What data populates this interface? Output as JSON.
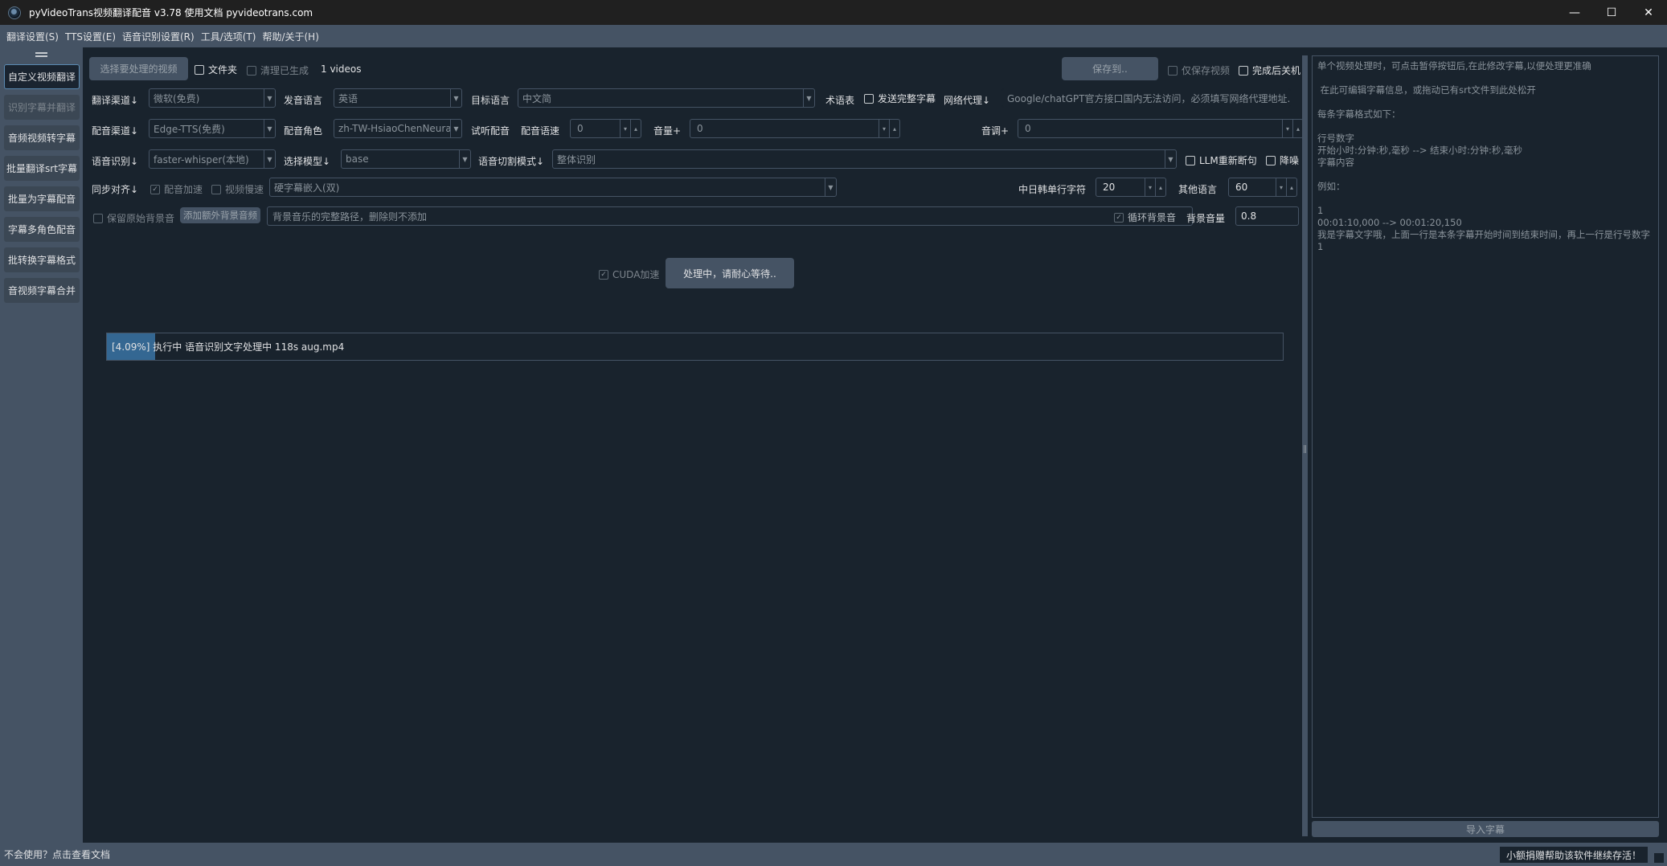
{
  "window": {
    "title": "pyVideoTrans视频翻译配音 v3.78  使用文档  pyvideotrans.com",
    "icon": "app-logo-icon",
    "minimize_glyph": "—",
    "maximize_glyph": "☐",
    "close_glyph": "✕"
  },
  "menu": [
    "翻译设置(S)",
    "TTS设置(E)",
    "语音识别设置(R)",
    "工具/选项(T)",
    "帮助/关于(H)"
  ],
  "sidebar": {
    "items": [
      "自定义视频翻译",
      "识别字幕并翻译",
      "音频视频转字幕",
      "批量翻译srt字幕",
      "批量为字幕配音",
      "字幕多角色配音",
      "批转换字幕格式",
      "音视频字幕合并"
    ]
  },
  "toolbar": {
    "select_video": "选择要处理的视频",
    "folder_label": "文件夹",
    "clear_generated": "清理已生成",
    "video_count": "1 videos",
    "save_to": "保存到..",
    "only_save_video": "仅保存视频",
    "shutdown_after": "完成后关机"
  },
  "row1": {
    "translate_channel_label": "翻译渠道↓",
    "translate_channel_value": "微软(免费)",
    "source_lang_label": "发音语言",
    "source_lang_value": "英语",
    "target_lang_label": "目标语言",
    "target_lang_value": "中文简",
    "glossary_label": "术语表",
    "send_full_subtitle": "发送完整字幕",
    "proxy_label": "网络代理↓",
    "proxy_placeholder": "Google/chatGPT官方接口国内无法访问，必须填写网络代理地址..."
  },
  "row2": {
    "dubbing_channel_label": "配音渠道↓",
    "dubbing_channel_value": "Edge-TTS(免费)",
    "voice_role_label": "配音角色",
    "voice_role_value": "zh-TW-HsiaoChenNeura",
    "listen_label": "试听配音",
    "speed_label": "配音语速",
    "speed_value": "0",
    "volume_label": "音量+",
    "volume_value": "0",
    "pitch_label": "音调+",
    "pitch_value": "0"
  },
  "row3": {
    "asr_label": "语音识别↓",
    "asr_value": "faster-whisper(本地)",
    "model_label": "选择模型↓",
    "model_value": "base",
    "split_mode_label": "语音切割模式↓",
    "split_mode_value": "整体识别",
    "llm_resegment": "LLM重新断句",
    "denoise": "降噪"
  },
  "row4": {
    "sync_label": "同步对齐↓",
    "dub_speedup": "配音加速",
    "video_slowdown": "视频慢速",
    "subtitle_embed_value": "硬字幕嵌入(双)",
    "cjk_chars_label": "中日韩单行字符",
    "cjk_chars_value": "20",
    "other_lang_label": "其他语言",
    "other_lang_value": "60"
  },
  "row5": {
    "keep_original_bg": "保留原始背景音",
    "add_bg_audio": "添加额外背景音频",
    "bg_audio_placeholder": "背景音乐的完整路径，删除则不添加",
    "loop_bg": "循环背景音",
    "bg_volume_label": "背景音量",
    "bg_volume_value": "0.8"
  },
  "action": {
    "cuda_label": "CUDA加速",
    "start_button": "处理中，请耐心等待.."
  },
  "progress": {
    "percent": 0.0409,
    "text": "[4.09%]  执行中 语音识别文字处理中 118s   aug.mp4"
  },
  "right_panel": {
    "lines": [
      "单个视频处理时，可点击暂停按钮后,在此修改字幕,以便处理更准确",
      "",
      " 在此可编辑字幕信息，或拖动已有srt文件到此处松开",
      "",
      "每条字幕格式如下：",
      "",
      "行号数字",
      "开始小时:分钟:秒,毫秒 --> 结束小时:分钟:秒,毫秒",
      "字幕内容",
      "",
      "例如：",
      "",
      "1",
      "00:01:10,000 --> 00:01:20,150",
      "我是字幕文字哦，上面一行是本条字幕开始时间到结束时间，再上一行是行号数字1"
    ],
    "import_button": "导入字幕"
  },
  "status": {
    "help_link": "不会使用？点击查看文档",
    "donate_text": "小额捐赠帮助该软件继续存活！"
  },
  "colors": {
    "background": "#19232d",
    "panel": "#455364",
    "accent": "#346792"
  }
}
